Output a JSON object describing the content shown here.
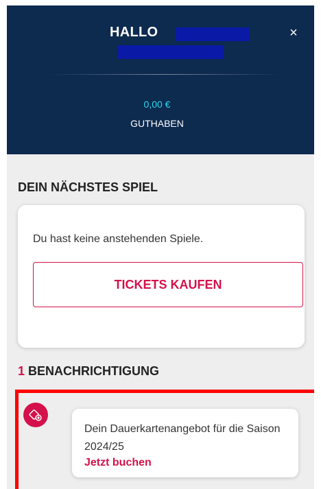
{
  "header": {
    "greeting": "HALLO",
    "close_symbol": "×",
    "balance_value": "0,00 €",
    "balance_label": "GUTHABEN"
  },
  "next_game": {
    "title": "DEIN NÄCHSTES SPIEL",
    "empty_message": "Du hast keine anstehenden Spiele.",
    "tickets_button": "TICKETS KAUFEN"
  },
  "notifications": {
    "count": "1",
    "title": "BENACHRICHTIGUNG",
    "items": [
      {
        "icon": "ticket-plus-icon",
        "text": "Dein Dauerkartenangebot für die Saison 2024/25",
        "link": "Jetzt buchen"
      }
    ]
  },
  "colors": {
    "header_bg": "#0d2a4f",
    "accent": "#d4114a",
    "balance": "#2bd9ef",
    "highlight_border": "#ff0000"
  }
}
